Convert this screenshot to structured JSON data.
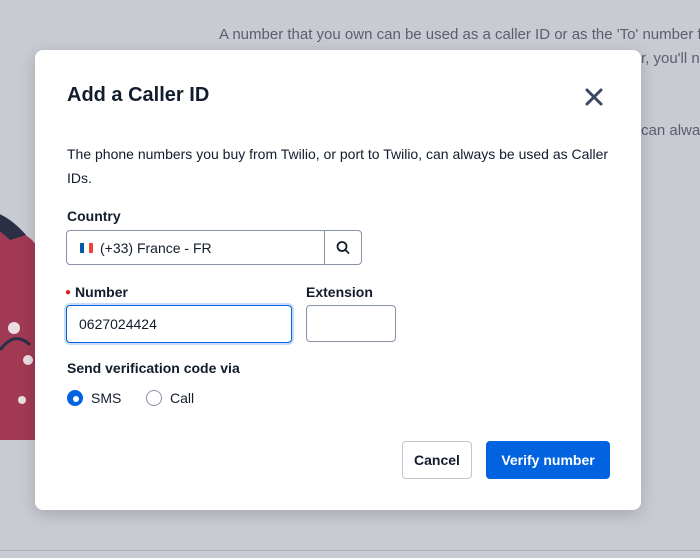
{
  "background": {
    "paragraph_line1": "A number that you own can be used as a caller ID or as the 'To' number fo",
    "paragraph_line2": "r, you'll n",
    "paragraph_line3": "can alway"
  },
  "modal": {
    "title": "Add a Caller ID",
    "description": "The phone numbers you buy from Twilio, or port to Twilio, can always be used as Caller IDs.",
    "country": {
      "label": "Country",
      "selected": "(+33) France - FR"
    },
    "number": {
      "label": "Number",
      "value": "0627024424",
      "required": true
    },
    "extension": {
      "label": "Extension",
      "value": ""
    },
    "verification": {
      "label": "Send verification code via",
      "options": [
        {
          "label": "SMS",
          "checked": true
        },
        {
          "label": "Call",
          "checked": false
        }
      ]
    },
    "buttons": {
      "cancel": "Cancel",
      "verify": "Verify number"
    }
  },
  "colors": {
    "accent": "#0263e0",
    "text": "#121c2d",
    "required": "#d61f1f"
  },
  "icons": {
    "close": "close-icon",
    "search": "search-icon",
    "flag": "flag-france-icon"
  }
}
